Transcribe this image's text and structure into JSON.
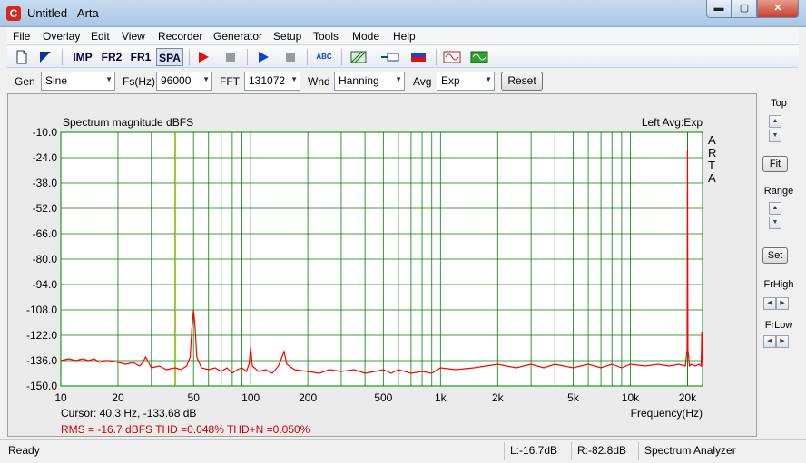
{
  "window": {
    "title": "Untitled - Arta",
    "app_icon_glyph": "C",
    "min_glyph": "▬",
    "max_glyph": "▢",
    "close_glyph": "✕"
  },
  "menu": [
    "File",
    "Overlay",
    "Edit",
    "View",
    "Recorder",
    "Generator",
    "Setup",
    "Tools",
    "Mode",
    "Help"
  ],
  "toolbar": {
    "imp_label": "IMP",
    "fr2_label": "FR2",
    "fr1_label": "FR1",
    "spa_label": "SPA",
    "abc_label": "ABC",
    "new_icon": "new-document-icon",
    "open_icon": "open-triangle-icon",
    "record_icon": "record-play-icon",
    "stop_icon": "stop-icon",
    "play_icon": "play-icon",
    "stop2_icon": "stop-icon"
  },
  "params": {
    "gen_label": "Gen",
    "gen_value": "Sine",
    "fs_label": "Fs(Hz)",
    "fs_value": "96000",
    "fft_label": "FFT",
    "fft_value": "131072",
    "wnd_label": "Wnd",
    "wnd_value": "Hanning",
    "avg_label": "Avg",
    "avg_value": "Exp",
    "reset_label": "Reset"
  },
  "side": {
    "top_label": "Top",
    "fit_label": "Fit",
    "range_label": "Range",
    "set_label": "Set",
    "frhigh_label": "FrHigh",
    "frlow_label": "FrLow"
  },
  "chart_data": {
    "type": "line",
    "title": "Spectrum magnitude dBFS",
    "channel_label": "Left  Avg:Exp",
    "brand_letters": [
      "A",
      "R",
      "T",
      "A"
    ],
    "xlabel": "Frequency(Hz)",
    "xscale": "log",
    "xlim": [
      10,
      24000
    ],
    "ylim": [
      -150,
      -10
    ],
    "y_ticks": [
      "-10.0",
      "-24.0",
      "-38.0",
      "-52.0",
      "-66.0",
      "-80.0",
      "-94.0",
      "-108.0",
      "-122.0",
      "-136.0",
      "-150.0"
    ],
    "x_ticks": [
      {
        "v": 10,
        "label": "10"
      },
      {
        "v": 20,
        "label": "20"
      },
      {
        "v": 50,
        "label": "50"
      },
      {
        "v": 100,
        "label": "100"
      },
      {
        "v": 200,
        "label": "200"
      },
      {
        "v": 500,
        "label": "500"
      },
      {
        "v": 1000,
        "label": "1k"
      },
      {
        "v": 2000,
        "label": "2k"
      },
      {
        "v": 5000,
        "label": "5k"
      },
      {
        "v": 10000,
        "label": "10k"
      },
      {
        "v": 20000,
        "label": "20k"
      }
    ],
    "cursor_freq": 40.3,
    "cursor_text": "Cursor:   40.3 Hz, -133.68 dB",
    "rms_text": "RMS =  -16.7 dBFS    THD =0.048%    THD+N =0.050%",
    "grid": true,
    "colors": {
      "background": "#ffffff",
      "grid": "#008000",
      "trace": "#ff0000",
      "cursor": "#c8c800",
      "info": "#d00000"
    },
    "series": [
      {
        "values": [
          [
            10,
            -136
          ],
          [
            11,
            -135
          ],
          [
            12,
            -136
          ],
          [
            13,
            -135
          ],
          [
            14,
            -136
          ],
          [
            15,
            -135
          ],
          [
            16,
            -137
          ],
          [
            17,
            -136
          ],
          [
            18,
            -136
          ],
          [
            20,
            -137
          ],
          [
            22,
            -138
          ],
          [
            24,
            -137
          ],
          [
            26,
            -139
          ],
          [
            27,
            -137
          ],
          [
            28,
            -134
          ],
          [
            29,
            -137
          ],
          [
            30,
            -140
          ],
          [
            33,
            -139
          ],
          [
            36,
            -141
          ],
          [
            40,
            -140
          ],
          [
            43,
            -141
          ],
          [
            46,
            -139
          ],
          [
            48,
            -134
          ],
          [
            49,
            -118
          ],
          [
            50,
            -108
          ],
          [
            51,
            -118
          ],
          [
            52,
            -134
          ],
          [
            55,
            -140
          ],
          [
            60,
            -141
          ],
          [
            65,
            -140
          ],
          [
            70,
            -142
          ],
          [
            75,
            -140
          ],
          [
            80,
            -143
          ],
          [
            85,
            -141
          ],
          [
            90,
            -140
          ],
          [
            95,
            -142
          ],
          [
            98,
            -138
          ],
          [
            99,
            -134
          ],
          [
            100,
            -128
          ],
          [
            101,
            -134
          ],
          [
            102,
            -139
          ],
          [
            110,
            -142
          ],
          [
            120,
            -141
          ],
          [
            130,
            -143
          ],
          [
            140,
            -139
          ],
          [
            145,
            -135
          ],
          [
            150,
            -131
          ],
          [
            155,
            -138
          ],
          [
            170,
            -141
          ],
          [
            200,
            -142
          ],
          [
            230,
            -143
          ],
          [
            260,
            -141
          ],
          [
            300,
            -142
          ],
          [
            350,
            -141
          ],
          [
            400,
            -143
          ],
          [
            450,
            -142
          ],
          [
            500,
            -141
          ],
          [
            550,
            -143
          ],
          [
            600,
            -141
          ],
          [
            700,
            -143
          ],
          [
            800,
            -142
          ],
          [
            900,
            -143
          ],
          [
            1000,
            -140
          ],
          [
            1200,
            -141
          ],
          [
            1500,
            -140
          ],
          [
            2000,
            -138
          ],
          [
            2500,
            -140
          ],
          [
            3000,
            -138
          ],
          [
            3500,
            -140
          ],
          [
            4000,
            -138
          ],
          [
            5000,
            -140
          ],
          [
            6000,
            -138
          ],
          [
            7000,
            -140
          ],
          [
            8000,
            -138
          ],
          [
            9000,
            -140
          ],
          [
            10000,
            -138
          ],
          [
            12000,
            -139
          ],
          [
            14000,
            -138
          ],
          [
            16000,
            -139
          ],
          [
            18000,
            -138
          ],
          [
            19500,
            -139
          ],
          [
            19900,
            -130
          ],
          [
            20000,
            -20
          ],
          [
            20100,
            -130
          ],
          [
            20500,
            -139
          ],
          [
            21000,
            -138
          ],
          [
            22000,
            -139
          ],
          [
            23000,
            -138
          ],
          [
            23600,
            -139
          ],
          [
            23800,
            -120
          ],
          [
            24000,
            -139
          ]
        ]
      }
    ]
  },
  "status": {
    "left": "Ready",
    "level_l": "L:-16.7dB",
    "level_r": "R:-82.8dB",
    "mode": "Spectrum Analyzer"
  }
}
